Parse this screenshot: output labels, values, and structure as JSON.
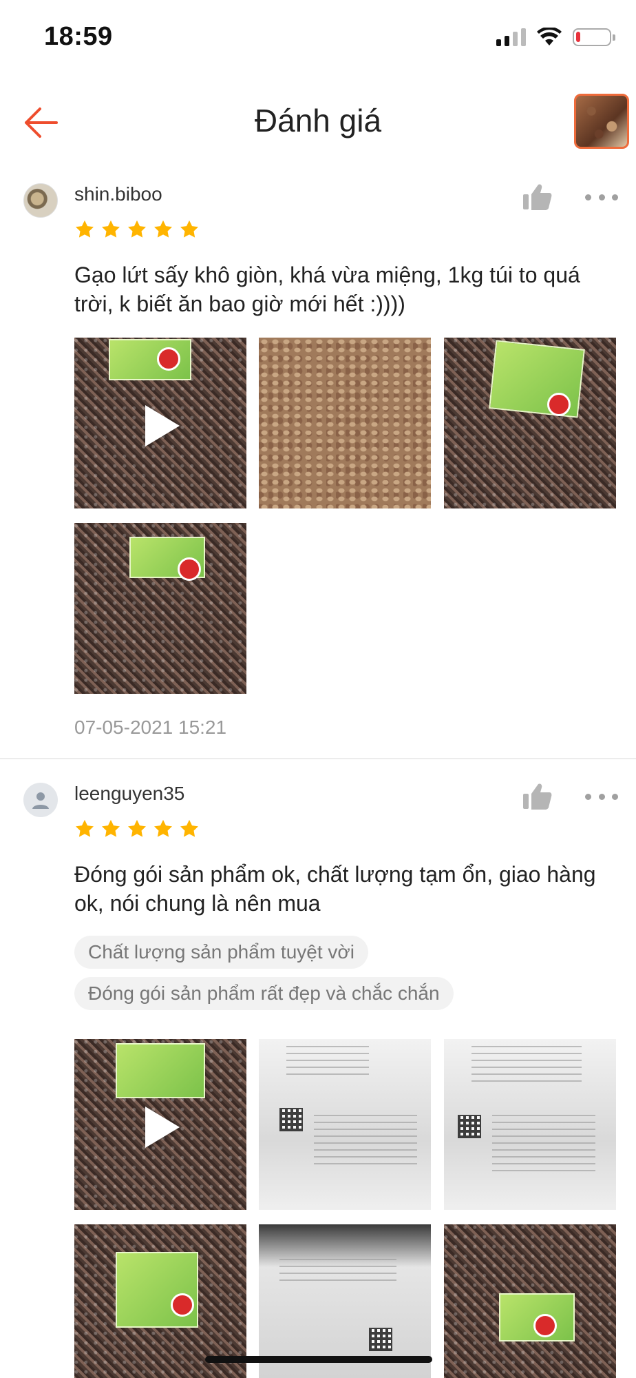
{
  "status_bar": {
    "time": "18:59",
    "battery_level": 0.1
  },
  "header": {
    "title": "Đánh giá",
    "back_icon": "arrow-left-icon",
    "product_thumbnail": "product-thumbnail"
  },
  "colors": {
    "accent": "#ee4d2d",
    "star": "#ffb400",
    "muted": "#999999"
  },
  "reviews": [
    {
      "username": "shin.biboo",
      "rating": 5,
      "comment": "Gạo lứt sấy khô giòn, khá vừa miệng, 1kg túi to quá trời, k biết ăn bao giờ mới hết :))))",
      "tags": [],
      "media_count": 4,
      "date": "07-05-2021 15:21"
    },
    {
      "username": "leenguyen35",
      "rating": 5,
      "comment": "Đóng gói sản phẩm ok, chất lượng tạm ổn, giao hàng ok, nói chung là nên mua",
      "tags": [
        "Chất lượng sản phẩm tuyệt vời",
        "Đóng gói sản phẩm rất đẹp và chắc chắn"
      ],
      "media_count": 6
    }
  ]
}
